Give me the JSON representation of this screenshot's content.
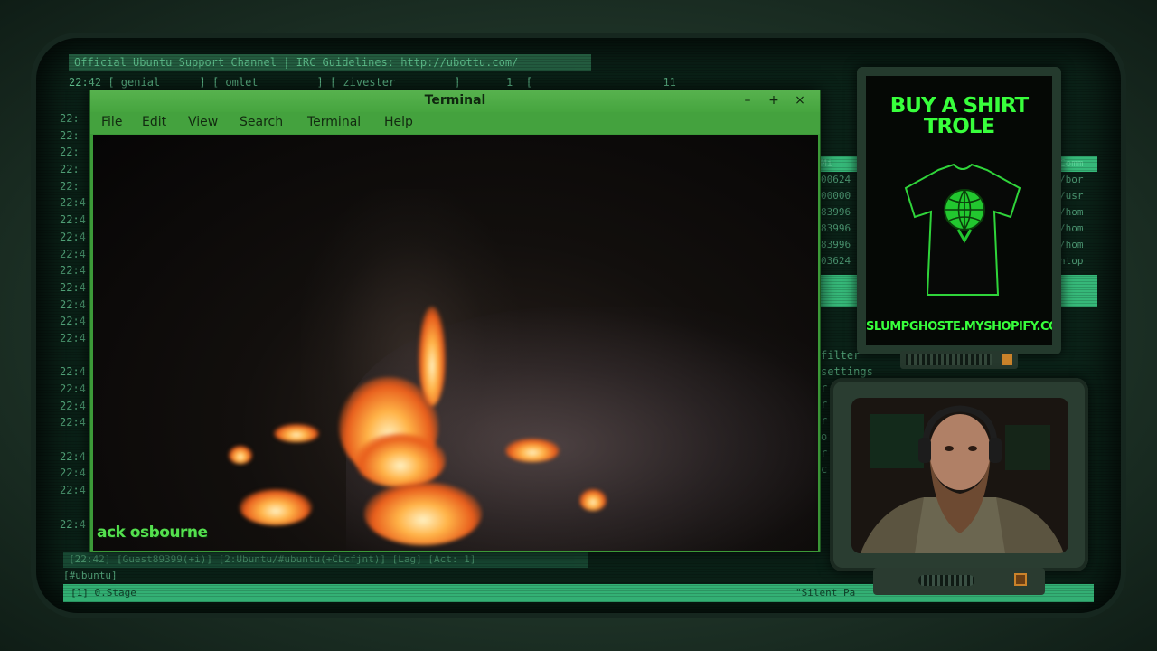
{
  "irc": {
    "topic": "Official Ubuntu Support Channel | IRC Guidelines: http://ubottu.com/",
    "nick_line": "22:42 [ genial      ] [ omlet         ] [ zivester         ]       1  [                    11",
    "timestamps": [
      "22:",
      "22:",
      "22:",
      "22:",
      "22:",
      "22:4",
      "22:4",
      "22:4",
      "22:4",
      "22:4",
      "22:4",
      "22:4",
      "22:4",
      "22:4",
      "",
      "22:4",
      "22:4",
      "22:4",
      "22:4",
      "",
      "22:4",
      "22:4",
      "22:4",
      "",
      "22:4"
    ],
    "status_line": "[22:42] [Guest89399(+i)] [2:Ubuntu/#ubuntu(+CLcfjnt)] [Lag] [Act: 1]",
    "input_line": "[#ubuntu]",
    "bottom_left": "[1] 0.Stage",
    "bottom_right": "\"Silent Pa",
    "right_list": [
      "filter",
      "settings",
      "r",
      "r",
      "r",
      "o",
      "r",
      "c"
    ],
    "right_rows": [
      "Mi",
      "00624",
      "00000",
      "83996",
      "83996",
      "83996",
      "03624"
    ],
    "right_rows_end": [
      "Comm",
      "/bor",
      "/usr",
      "/hom",
      "/hom",
      "/hom",
      "htop"
    ]
  },
  "terminal": {
    "title": "Terminal",
    "minimize": "–",
    "maximize": "+",
    "close": "×",
    "menu": [
      "File",
      "Edit",
      "View",
      "Search",
      "Terminal",
      "Help"
    ],
    "caption": "ack osbourne"
  },
  "ad": {
    "title_line1": "BUY A SHIRT",
    "title_line2": "TROLE",
    "url": "SLUMPGHOSTE.MYSHOPIFY.COM",
    "accent": "#38ff3c"
  },
  "icons": {
    "shirt": "tshirt-icon",
    "globe": "globe-icon",
    "webcam": "webcam-feed"
  }
}
